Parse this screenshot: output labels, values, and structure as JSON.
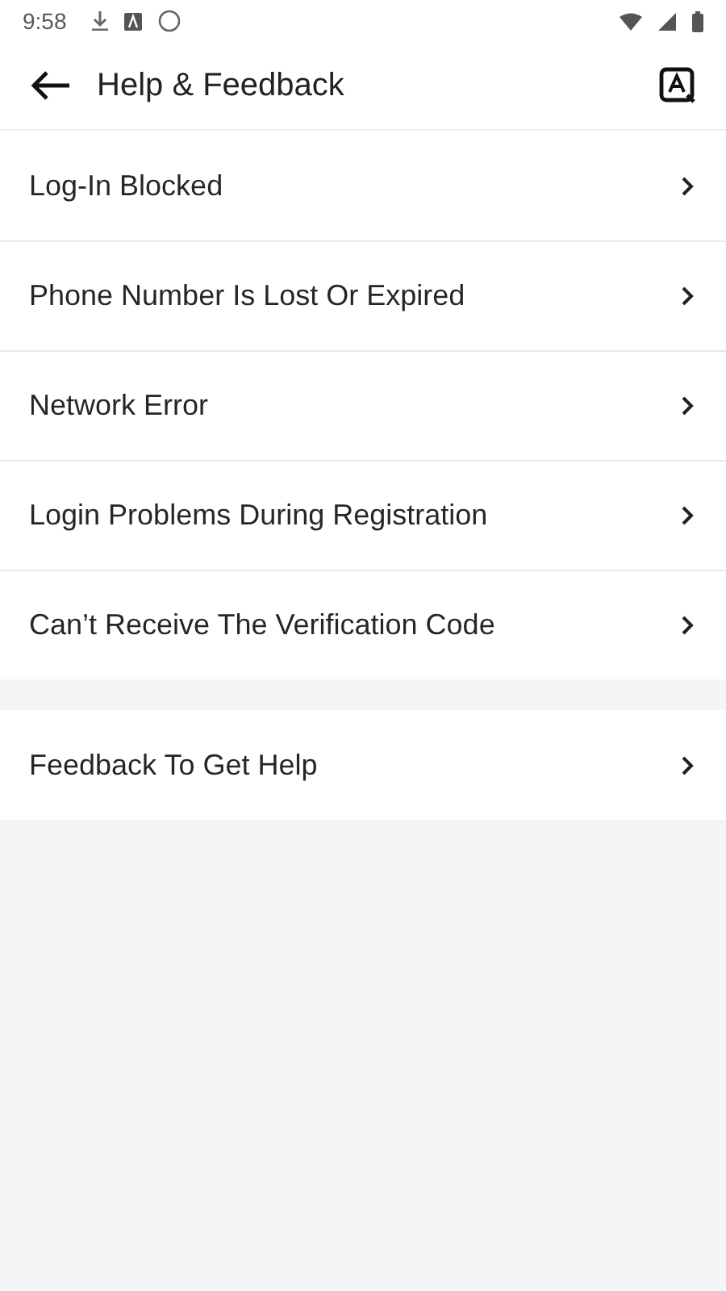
{
  "status_bar": {
    "time": "9:58"
  },
  "header": {
    "title": "Help & Feedback"
  },
  "sections": [
    {
      "items": [
        {
          "label": "Log-In Blocked"
        },
        {
          "label": "Phone Number Is Lost Or Expired"
        },
        {
          "label": "Network Error"
        },
        {
          "label": "Login Problems During Registration"
        },
        {
          "label": "Can’t Receive The Verification Code"
        }
      ]
    },
    {
      "items": [
        {
          "label": "Feedback To Get Help"
        }
      ]
    }
  ]
}
